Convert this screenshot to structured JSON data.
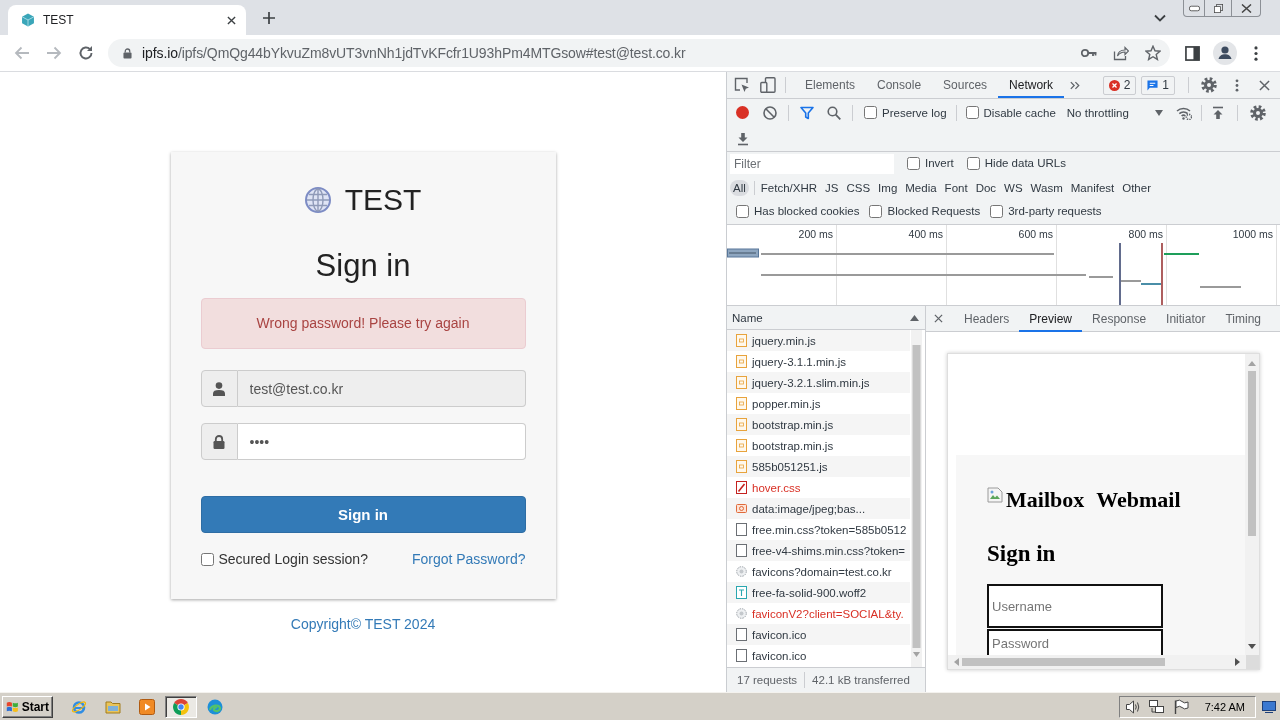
{
  "browser": {
    "tabs": [
      {
        "title": "TEST",
        "selected": true
      }
    ],
    "address": {
      "host": "ipfs.io",
      "path": "/ipfs/QmQg44bYkvuZm8vUT3vnNh1jdTvKFcfr1U93hPm4MTGsow#test@test.co.kr"
    }
  },
  "login": {
    "brand": "TEST",
    "heading": "Sign in",
    "alert": "Wrong password! Please try again",
    "fields": [
      {
        "kind": "user",
        "value": "test@test.co.kr",
        "disabled": true
      },
      {
        "kind": "lock",
        "value": "••••",
        "disabled": false
      }
    ],
    "submit": "Sign in",
    "remember": {
      "label": "Secured Login session?",
      "checked": false
    },
    "forgot": "Forgot Password?",
    "footer": "Copyright© TEST 2024"
  },
  "devtools": {
    "tabs": [
      {
        "label": "Elements",
        "selected": false
      },
      {
        "label": "Console",
        "selected": false
      },
      {
        "label": "Sources",
        "selected": false
      },
      {
        "label": "Network",
        "selected": true
      }
    ],
    "errors": "2",
    "messages": "1",
    "recording": true,
    "preserve_log": {
      "label": "Preserve log",
      "checked": false
    },
    "disable_cache": {
      "label": "Disable cache",
      "checked": false
    },
    "throttling": "No throttling",
    "filter": {
      "placeholder": "Filter"
    },
    "filter_options": [
      {
        "label": "Invert",
        "checked": false
      },
      {
        "label": "Hide data URLs",
        "checked": false
      }
    ],
    "types": [
      {
        "label": "All",
        "selected": true
      },
      {
        "label": "Fetch/XHR",
        "selected": false
      },
      {
        "label": "JS",
        "selected": false
      },
      {
        "label": "CSS",
        "selected": false
      },
      {
        "label": "Img",
        "selected": false
      },
      {
        "label": "Media",
        "selected": false
      },
      {
        "label": "Font",
        "selected": false
      },
      {
        "label": "Doc",
        "selected": false
      },
      {
        "label": "WS",
        "selected": false
      },
      {
        "label": "Wasm",
        "selected": false
      },
      {
        "label": "Manifest",
        "selected": false
      },
      {
        "label": "Other",
        "selected": false
      }
    ],
    "extra_filters": [
      {
        "label": "Has blocked cookies",
        "checked": false
      },
      {
        "label": "Blocked Requests",
        "checked": false
      },
      {
        "label": "3rd-party requests",
        "checked": false
      }
    ],
    "timeline_ticks": [
      "200 ms",
      "400 ms",
      "600 ms",
      "800 ms",
      "1000 ms"
    ],
    "name_column": "Name",
    "requests": [
      {
        "name": "jquery.min.js",
        "kind": "script",
        "failed": false
      },
      {
        "name": "jquery-3.1.1.min.js",
        "kind": "script",
        "failed": false
      },
      {
        "name": "jquery-3.2.1.slim.min.js",
        "kind": "script",
        "failed": false
      },
      {
        "name": "popper.min.js",
        "kind": "script",
        "failed": false
      },
      {
        "name": "bootstrap.min.js",
        "kind": "script",
        "failed": false
      },
      {
        "name": "bootstrap.min.js",
        "kind": "script",
        "failed": false
      },
      {
        "name": "585b051251.js",
        "kind": "script",
        "failed": false
      },
      {
        "name": "hover.css",
        "kind": "stylesheet",
        "failed": true
      },
      {
        "name": "data:image/jpeg;bas...",
        "kind": "image",
        "failed": false
      },
      {
        "name": "free.min.css?token=585b0512",
        "kind": "other",
        "failed": false
      },
      {
        "name": "free-v4-shims.min.css?token=",
        "kind": "other",
        "failed": false
      },
      {
        "name": "favicons?domain=test.co.kr",
        "kind": "icon",
        "failed": false
      },
      {
        "name": "free-fa-solid-900.woff2",
        "kind": "font",
        "failed": false
      },
      {
        "name": "faviconV2?client=SOCIAL&ty.",
        "kind": "icon",
        "failed": true
      },
      {
        "name": "favicon.ico",
        "kind": "other",
        "failed": false
      },
      {
        "name": "favicon.ico",
        "kind": "other",
        "failed": false
      }
    ],
    "request_count": "17 requests",
    "transferred": "42.1 kB transferred",
    "detail_tabs": [
      {
        "label": "Headers",
        "selected": false
      },
      {
        "label": "Preview",
        "selected": true
      },
      {
        "label": "Response",
        "selected": false
      },
      {
        "label": "Initiator",
        "selected": false
      },
      {
        "label": "Timing",
        "selected": false
      }
    ],
    "preview": {
      "image_alt": "Mailbox",
      "title": "Webmail",
      "heading": "Sign in",
      "fields": [
        {
          "placeholder": "Username"
        },
        {
          "placeholder": "Password"
        }
      ]
    }
  },
  "taskbar": {
    "start": "Start",
    "apps": [
      {
        "kind": "ie",
        "selected": false
      },
      {
        "kind": "explorer",
        "selected": false
      },
      {
        "kind": "media",
        "selected": false
      },
      {
        "kind": "chrome",
        "selected": true
      },
      {
        "kind": "edge",
        "selected": false
      }
    ],
    "clock": "7:42 AM"
  }
}
